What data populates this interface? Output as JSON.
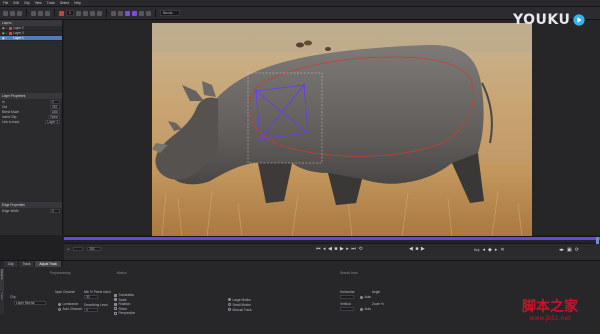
{
  "menu": [
    "File",
    "Edit",
    "Clip",
    "View",
    "Track",
    "Select",
    "Help"
  ],
  "toolbar": {
    "frame_value": "0",
    "zoom_value": "Mocha"
  },
  "layers_panel": {
    "title": "Layers",
    "items": [
      {
        "name": "Layer 2",
        "color": "#d6453a",
        "selected": false
      },
      {
        "name": "Layer 3",
        "color": "#d6453a",
        "selected": false
      },
      {
        "name": "Layer 1",
        "color": "#3f7fe0",
        "selected": true
      }
    ]
  },
  "layer_properties": {
    "title": "Layer Properties",
    "rows": [
      {
        "label": "In",
        "value": "0"
      },
      {
        "label": "Out",
        "value": "251"
      },
      {
        "label": "Blend Mode",
        "value": "Add"
      },
      {
        "label": "Insert Clip",
        "value": "None"
      },
      {
        "label": "Link to track",
        "value": "Layer 1"
      }
    ]
  },
  "edge_properties": {
    "title": "Edge Properties",
    "label": "Edge Width",
    "value": "0"
  },
  "timeline": {
    "frame_field": "251",
    "key_label": "Key"
  },
  "bottom_panel": {
    "tabs": [
      "Clip",
      "Track",
      "Adjust Track"
    ],
    "active_tab": "Adjust Track",
    "side_tabs": [
      "Params",
      "Track"
    ],
    "section_left": "Preprocessing",
    "section_mid": "Motion",
    "section_right": "Search Area",
    "input_label": "Input Channel",
    "input_options": [
      "Luminance",
      "Auto Channel"
    ],
    "minpix_label": "Min % Pixels Used",
    "minpix_value": "30",
    "smoothing_label": "Smoothing Level",
    "smoothing_value": "0",
    "motion_options": [
      "Translation",
      "Scale",
      "Rotation",
      "Shear",
      "Perspective"
    ],
    "motion_extra": [
      "Large Motion",
      "Small Motion",
      "Manual Track"
    ],
    "search_labels": [
      "Horizontal",
      "Vertical",
      "Angle",
      "Zoom %"
    ],
    "search_value": "Auto",
    "clip_label": "Clip",
    "clip_value": "Layer Mocha"
  },
  "watermarks": {
    "brand": "YOUKU",
    "site_cn": "脚本之家",
    "site_url": "www.jb51.net"
  }
}
